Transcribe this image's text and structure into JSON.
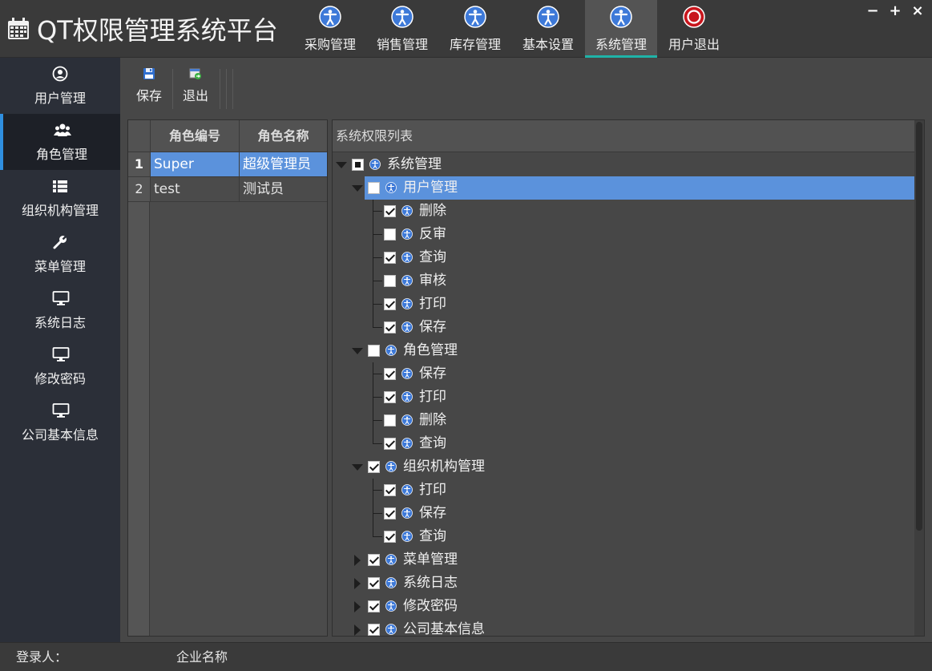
{
  "app": {
    "title": "QT权限管理系统平台"
  },
  "nav": {
    "tabs": [
      {
        "label": "采购管理",
        "icon": "accessibility-icon",
        "active": false
      },
      {
        "label": "销售管理",
        "icon": "accessibility-icon",
        "active": false
      },
      {
        "label": "库存管理",
        "icon": "accessibility-icon",
        "active": false
      },
      {
        "label": "基本设置",
        "icon": "accessibility-icon",
        "active": false
      },
      {
        "label": "系统管理",
        "icon": "accessibility-icon",
        "active": true
      },
      {
        "label": "用户退出",
        "icon": "power-icon",
        "active": false
      }
    ],
    "window_controls": {
      "minimize": "−",
      "maximize": "+",
      "close": "×"
    }
  },
  "sidebar": {
    "items": [
      {
        "label": "用户管理",
        "icon": "user-circle-icon",
        "active": false
      },
      {
        "label": "角色管理",
        "icon": "users-icon",
        "active": true
      },
      {
        "label": "组织机构管理",
        "icon": "list-icon",
        "active": false
      },
      {
        "label": "菜单管理",
        "icon": "wrench-icon",
        "active": false
      },
      {
        "label": "系统日志",
        "icon": "monitor-icon",
        "active": false
      },
      {
        "label": "修改密码",
        "icon": "monitor-icon",
        "active": false
      },
      {
        "label": "公司基本信息",
        "icon": "monitor-icon",
        "active": false
      }
    ]
  },
  "toolbar": {
    "save_label": "保存",
    "exit_label": "退出"
  },
  "roles": {
    "columns": [
      "角色编号",
      "角色名称"
    ],
    "rows": [
      {
        "num": "1",
        "code": "Super",
        "name": "超级管理员",
        "selected": true
      },
      {
        "num": "2",
        "code": "test",
        "name": "测试员",
        "selected": false
      }
    ]
  },
  "permissions": {
    "header": "系统权限列表",
    "tree": [
      {
        "label": "系统管理",
        "level": 0,
        "expanded": true,
        "state": "partial"
      },
      {
        "label": "用户管理",
        "level": 1,
        "expanded": true,
        "state": "unchecked",
        "selected": true
      },
      {
        "label": "删除",
        "level": 2,
        "state": "checked"
      },
      {
        "label": "反审",
        "level": 2,
        "state": "unchecked"
      },
      {
        "label": "查询",
        "level": 2,
        "state": "checked"
      },
      {
        "label": "审核",
        "level": 2,
        "state": "unchecked"
      },
      {
        "label": "打印",
        "level": 2,
        "state": "checked"
      },
      {
        "label": "保存",
        "level": 2,
        "state": "checked"
      },
      {
        "label": "角色管理",
        "level": 1,
        "expanded": true,
        "state": "unchecked"
      },
      {
        "label": "保存",
        "level": 2,
        "state": "checked"
      },
      {
        "label": "打印",
        "level": 2,
        "state": "checked"
      },
      {
        "label": "删除",
        "level": 2,
        "state": "unchecked"
      },
      {
        "label": "查询",
        "level": 2,
        "state": "checked"
      },
      {
        "label": "组织机构管理",
        "level": 1,
        "expanded": true,
        "state": "checked"
      },
      {
        "label": "打印",
        "level": 2,
        "state": "checked"
      },
      {
        "label": "保存",
        "level": 2,
        "state": "checked"
      },
      {
        "label": "查询",
        "level": 2,
        "state": "checked"
      },
      {
        "label": "菜单管理",
        "level": 1,
        "expanded": false,
        "state": "checked"
      },
      {
        "label": "系统日志",
        "level": 1,
        "expanded": false,
        "state": "checked"
      },
      {
        "label": "修改密码",
        "level": 1,
        "expanded": false,
        "state": "checked"
      },
      {
        "label": "公司基本信息",
        "level": 1,
        "expanded": false,
        "state": "checked"
      }
    ]
  },
  "status": {
    "login_label": "登录人：",
    "company_label": "企业名称"
  },
  "colors": {
    "accent_teal": "#1fb3a8",
    "selection_blue": "#5b92dc",
    "icon_blue": "#3d79d8",
    "power_red": "#c8161d"
  }
}
